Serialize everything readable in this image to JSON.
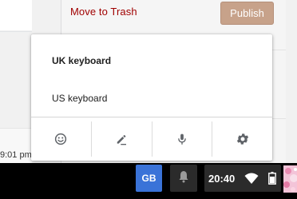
{
  "background": {
    "trash_link": "Move to Trash",
    "publish_button": "Publish",
    "partial_time": "9:01 pm"
  },
  "ime_menu": {
    "items": [
      {
        "label": "UK keyboard",
        "selected": true
      },
      {
        "label": "US keyboard",
        "selected": false
      }
    ],
    "toolbar": [
      {
        "icon": "emoji-icon"
      },
      {
        "icon": "handwriting-pen-icon"
      },
      {
        "icon": "microphone-icon"
      },
      {
        "icon": "settings-gear-icon"
      }
    ]
  },
  "shelf": {
    "ime_indicator": "GB",
    "notification_icon": "bell-icon",
    "clock": "20:40",
    "wifi_icon": "wifi-icon",
    "battery_icon": "battery-icon",
    "avatar_icon": "user-avatar"
  },
  "colors": {
    "trash_link": "#a00000",
    "publish_button_bg": "#c7a28a",
    "ime_indicator_bg": "#3a73d8",
    "shelf_bg": "#000000",
    "tray_bg": "#2b2b2b"
  }
}
